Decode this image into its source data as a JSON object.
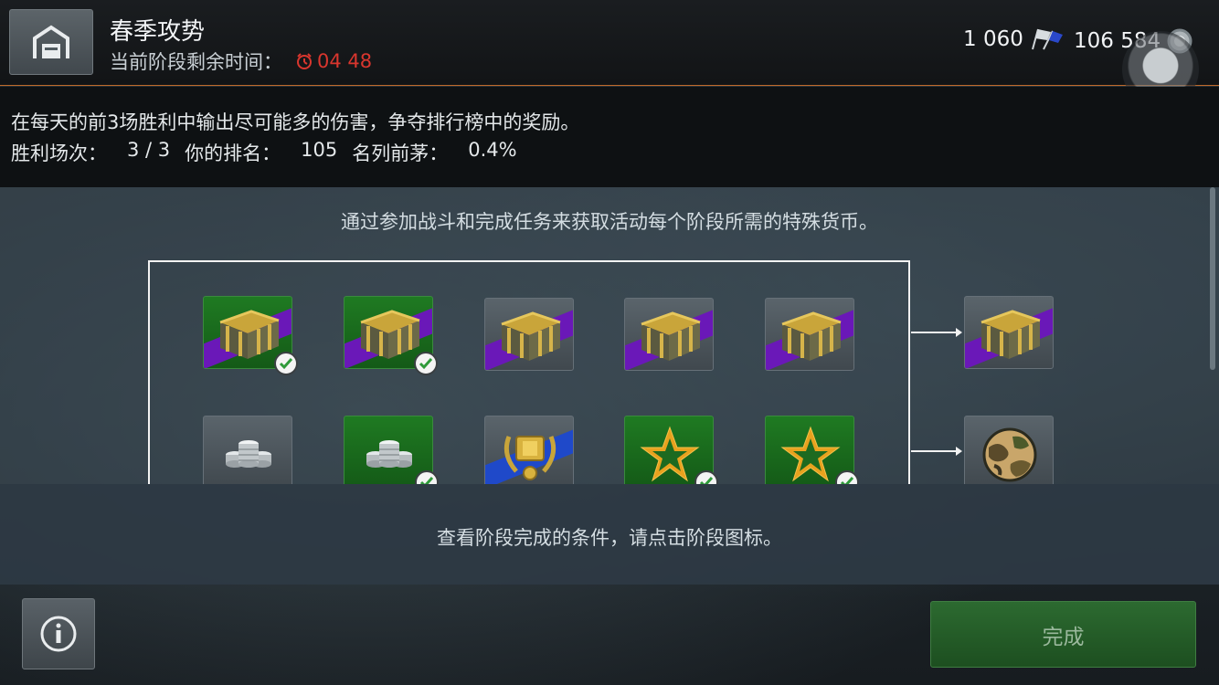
{
  "header": {
    "title": "春季攻势",
    "subtitle_label": "当前阶段剩余时间：",
    "timer": "04 48",
    "flags_value": "1 060",
    "silver_value": "106 584"
  },
  "description": {
    "line1": "在每天的前3场胜利中输出尽可能多的伤害，争夺排行榜中的奖励。",
    "wins_label": "胜利场次：",
    "wins_value": "3 / 3",
    "rank_label": "你的排名：",
    "rank_value": "105",
    "top_label": "名列前茅：",
    "top_value": "0.4%"
  },
  "stage_panel": {
    "intro": "通过参加战斗和完成任务来获取活动每个阶段所需的特殊货币。",
    "row1": [
      {
        "icon": "crate",
        "bg": "green",
        "completed": true
      },
      {
        "icon": "crate",
        "bg": "green",
        "completed": true
      },
      {
        "icon": "crate",
        "bg": "grey",
        "completed": false
      },
      {
        "icon": "crate",
        "bg": "grey",
        "completed": false
      },
      {
        "icon": "crate",
        "bg": "grey",
        "completed": false
      }
    ],
    "row2": [
      {
        "icon": "silver-coins",
        "bg": "grey",
        "completed": false
      },
      {
        "icon": "silver-coins",
        "bg": "green",
        "completed": true
      },
      {
        "icon": "gold-emblem",
        "bg": "grey",
        "completed": false
      },
      {
        "icon": "star",
        "bg": "green",
        "completed": true
      },
      {
        "icon": "star",
        "bg": "green",
        "completed": true
      }
    ],
    "rewards": [
      {
        "icon": "crate",
        "bg": "grey"
      },
      {
        "icon": "camo-emblem",
        "bg": "grey"
      }
    ]
  },
  "hint": "查看阶段完成的条件，请点击阶段图标。",
  "done_label": "完成",
  "colors": {
    "accent_orange": "#c06a2a",
    "timer_red": "#d9362e",
    "complete_green": "#1f7a22",
    "purple_stripe": "#6a18b8",
    "blue_stripe": "#1f49c9"
  }
}
